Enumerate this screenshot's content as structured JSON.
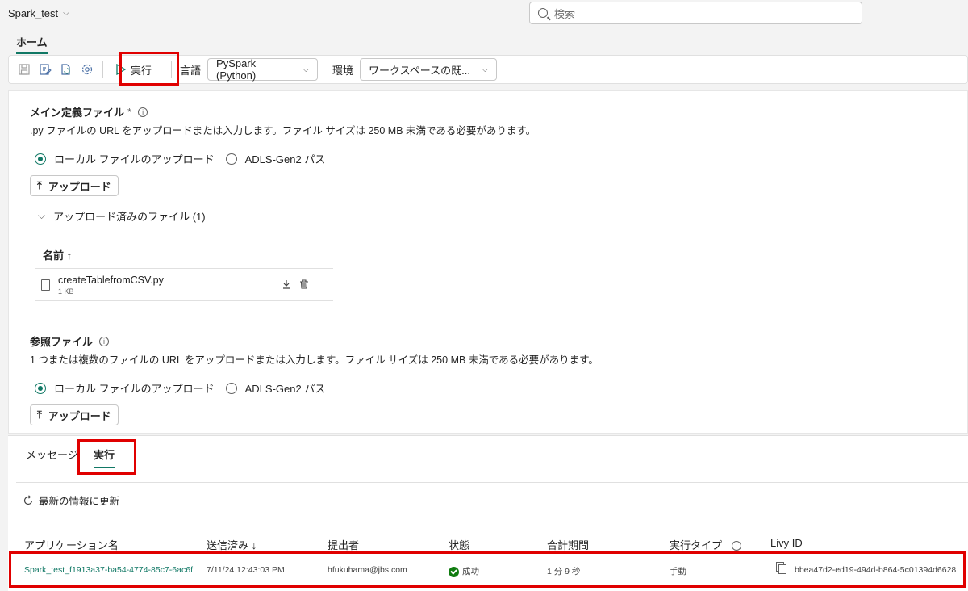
{
  "app": {
    "title": "Spark_test"
  },
  "search": {
    "placeholder": "検索"
  },
  "ribbon": {
    "home_tab": "ホーム"
  },
  "toolbar": {
    "run_label": "実行",
    "language_label": "言語",
    "language_value": "PySpark (Python)",
    "environment_label": "環境",
    "environment_value": "ワークスペースの既..."
  },
  "main_def": {
    "title": "メイン定義ファイル",
    "required_mark": "*",
    "description": ".py ファイルの URL をアップロードまたは入力します。ファイル サイズは 250 MB 未満である必要があります。",
    "radio_local": "ローカル ファイルのアップロード",
    "radio_adls": "ADLS-Gen2 パス",
    "upload_label": "アップロード",
    "uploaded_expander": "アップロード済みのファイル (1)",
    "table_header_name": "名前 ↑",
    "file": {
      "name": "createTablefromCSV.py",
      "size": "1 KB"
    }
  },
  "ref_files": {
    "title": "参照ファイル",
    "description": "1 つまたは複数のファイルの URL をアップロードまたは入力します。ファイル サイズは 250 MB 未満である必要があります。",
    "radio_local": "ローカル ファイルのアップロード",
    "radio_adls": "ADLS-Gen2 パス",
    "upload_label": "アップロード"
  },
  "bottom_tabs": {
    "messages": "メッセージ",
    "runs": "実行"
  },
  "refresh_label": "最新の情報に更新",
  "runs_table": {
    "headers": {
      "app_name": "アプリケーション名",
      "submitted": "送信済み ↓",
      "submitter": "提出者",
      "status": "状態",
      "duration": "合計期間",
      "run_type": "実行タイプ",
      "livy_id": "Livy ID"
    },
    "row": {
      "app_name": "Spark_test_f1913a37-ba54-4774-85c7-6ac6f",
      "submitted": "7/11/24 12:43:03 PM",
      "submitter": "hfukuhama@jbs.com",
      "status": "成功",
      "duration": "1 分 9 秒",
      "run_type": "手動",
      "livy_id": "bbea47d2-ed19-494d-b864-5c01394d6628"
    }
  },
  "colors": {
    "accent": "#117865",
    "highlight": "#e00000",
    "success": "#107c10"
  }
}
